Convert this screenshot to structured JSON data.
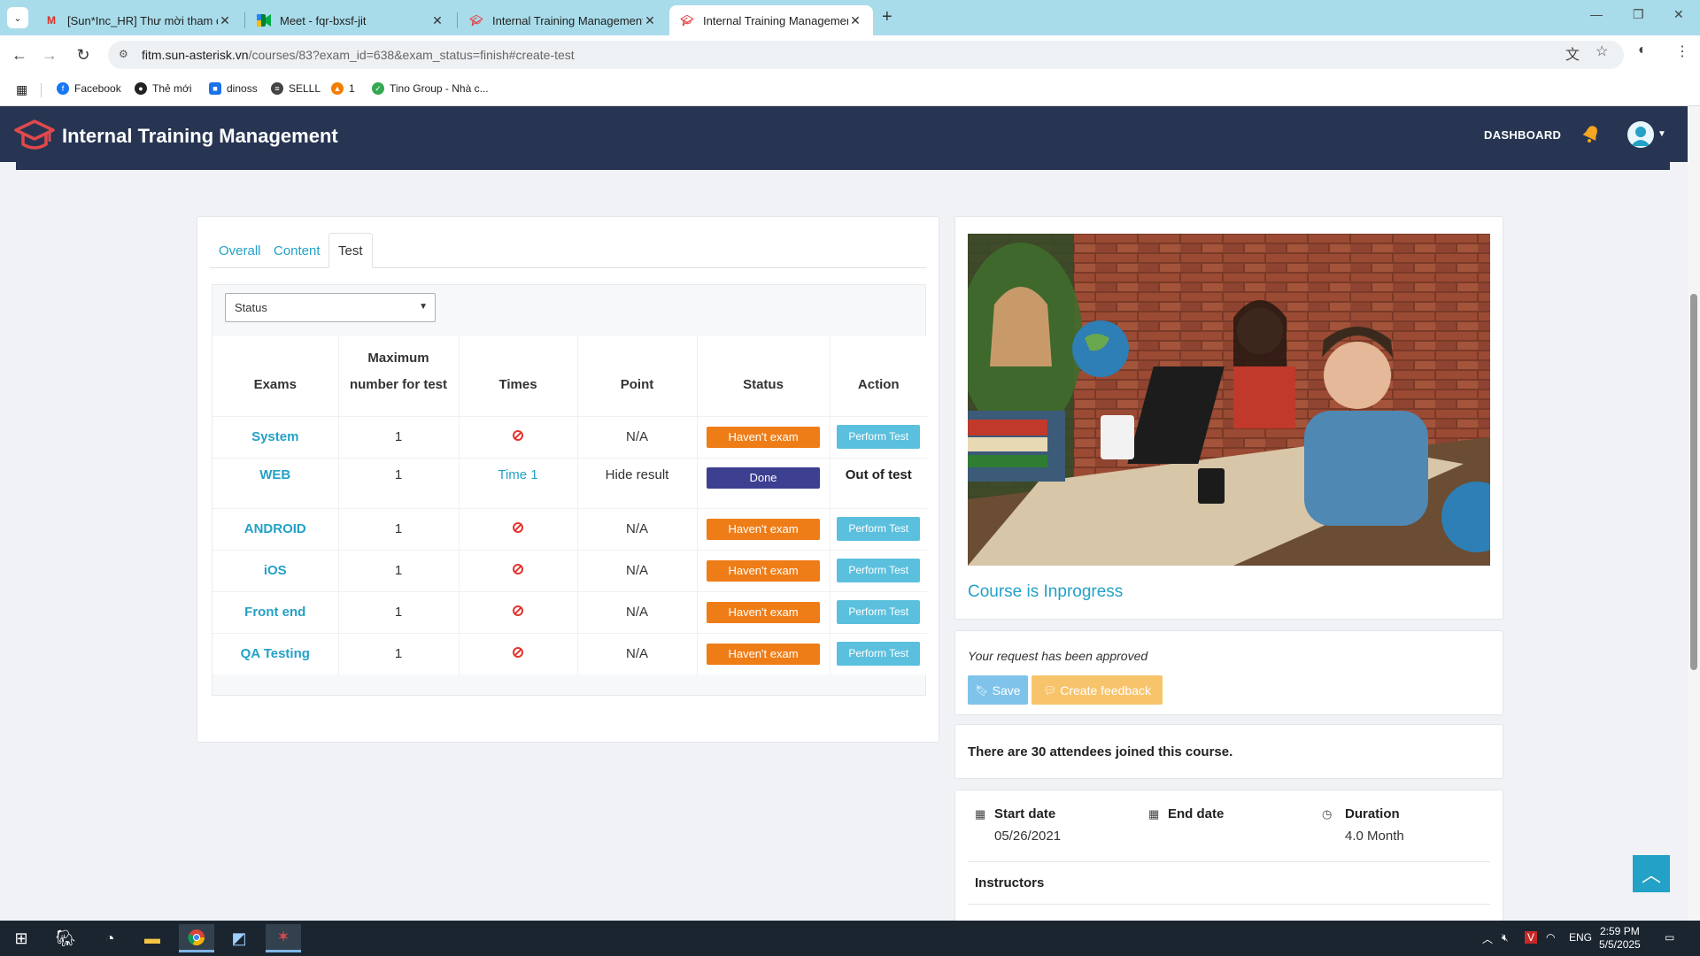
{
  "browser": {
    "tabs": [
      {
        "title": "[Sun*Inc_HR] Thư mời tham dự",
        "icon": "gmail-icon"
      },
      {
        "title": "Meet - fqr-bxsf-jit",
        "icon": "meet-icon"
      },
      {
        "title": "Internal Training Management",
        "icon": "itm-icon"
      },
      {
        "title": "Internal Training Management",
        "icon": "itm-icon"
      }
    ],
    "url_host": "fitm.sun-asterisk.vn",
    "url_path": "/courses/83?exam_id=638&exam_status=finish#create-test",
    "bookmarks": [
      {
        "label": "Facebook"
      },
      {
        "label": "Thẻ mới"
      },
      {
        "label": "dinoss"
      },
      {
        "label": "SELLL"
      },
      {
        "label": "1"
      },
      {
        "label": "Tino Group - Nhà c..."
      }
    ]
  },
  "navbar": {
    "brand": "Internal Training Management",
    "dashboard": "DASHBOARD"
  },
  "tabs": [
    "Overall",
    "Content",
    "Test"
  ],
  "filter": {
    "selected": "Status"
  },
  "table": {
    "headers": {
      "exams": "Exams",
      "max1": "Maximum",
      "max2": "number for test",
      "times": "Times",
      "point": "Point",
      "status": "Status",
      "action": "Action"
    },
    "rows": [
      {
        "exam": "System",
        "max": "1",
        "time": "",
        "point": "N/A",
        "status": "Haven't exam",
        "action": "Perform Test"
      },
      {
        "exam": "WEB",
        "max": "1",
        "time": "Time 1",
        "point": "Hide result",
        "status": "Done",
        "action": "Out of test"
      },
      {
        "exam": "ANDROID",
        "max": "1",
        "time": "",
        "point": "N/A",
        "status": "Haven't exam",
        "action": "Perform Test"
      },
      {
        "exam": "iOS",
        "max": "1",
        "time": "",
        "point": "N/A",
        "status": "Haven't exam",
        "action": "Perform Test"
      },
      {
        "exam": "Front end",
        "max": "1",
        "time": "",
        "point": "N/A",
        "status": "Haven't exam",
        "action": "Perform Test"
      },
      {
        "exam": "QA Testing",
        "max": "1",
        "time": "",
        "point": "N/A",
        "status": "Haven't exam",
        "action": "Perform Test"
      }
    ]
  },
  "course": {
    "status": "Course is Inprogress",
    "request_message": "Your request has been approved",
    "save_label": "Save",
    "feedback_label": "Create feedback",
    "attendees": "There are 30 attendees joined this course.",
    "start_label": "Start date",
    "start_value": "05/26/2021",
    "end_label": "End date",
    "end_value": "",
    "duration_label": "Duration",
    "duration_value": "4.0 Month",
    "instructors_label": "Instructors"
  },
  "taskbar": {
    "lang": "ENG",
    "time": "2:59 PM",
    "date": "5/5/2025"
  },
  "colors": {
    "navbar": "#273552",
    "accent": "#23a1c6",
    "badge_orange": "#ef7d17",
    "badge_done": "#3d3f91",
    "perform_btn": "#5bc0de",
    "save_btn": "#7fc3ea",
    "feedback_btn": "#f8c46b"
  }
}
